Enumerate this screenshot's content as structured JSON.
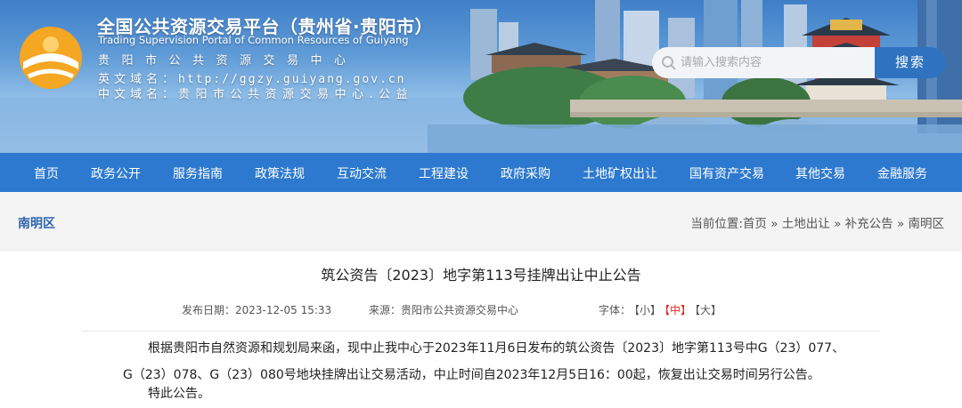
{
  "header": {
    "title_cn": "全国公共资源交易平台（贵州省·贵阳市）",
    "title_en": "Trading Supervision Portal of Common Resources of Guiyang",
    "center_name": "贵阳市公共资源交易中心",
    "en_domain_label": "英文域名：",
    "en_domain_value": "http://ggzy.guiyang.gov.cn",
    "cn_domain_label": "中文域名：",
    "cn_domain_value": "贵阳市公共资源交易中心.公益"
  },
  "search": {
    "placeholder": "请输入搜索内容",
    "button_label": "搜索"
  },
  "nav": {
    "items": [
      "首页",
      "政务公开",
      "服务指南",
      "政策法规",
      "互动交流",
      "工程建设",
      "政府采购",
      "土地矿权出让",
      "国有资产交易",
      "其他交易",
      "金融服务"
    ]
  },
  "location": {
    "area": "南明区",
    "breadcrumb_prefix": "当前位置:",
    "crumbs": [
      "首页",
      "土地出让",
      "补充公告",
      "南明区"
    ],
    "separator": "»"
  },
  "article": {
    "title": "筑公资告〔2023〕地字第113号挂牌出让中止公告",
    "publish_label": "发布日期：",
    "publish_date": "2023-12-05 15:33",
    "source_label": "来源：",
    "source_value": "贵阳市公共资源交易中心",
    "font_label": "字体：",
    "font_small": "【小】",
    "font_medium": "【中】",
    "font_large": "【大】",
    "body": "根据贵阳市自然资源和规划局来函，现中止我中心于2023年11月6日发布的筑公资告〔2023〕地字第113号中G（23）077、G（23）078、G（23）080号地块挂牌出让交易活动，中止时间自2023年12月5日16：00起，恢复出让交易时间另行公告。",
    "closing": "特此公告。"
  },
  "colors": {
    "nav_bg": "#2d79cf",
    "search_button": "#2f72c0",
    "area_text": "#2d65ad",
    "font_active": "#e0271e"
  }
}
